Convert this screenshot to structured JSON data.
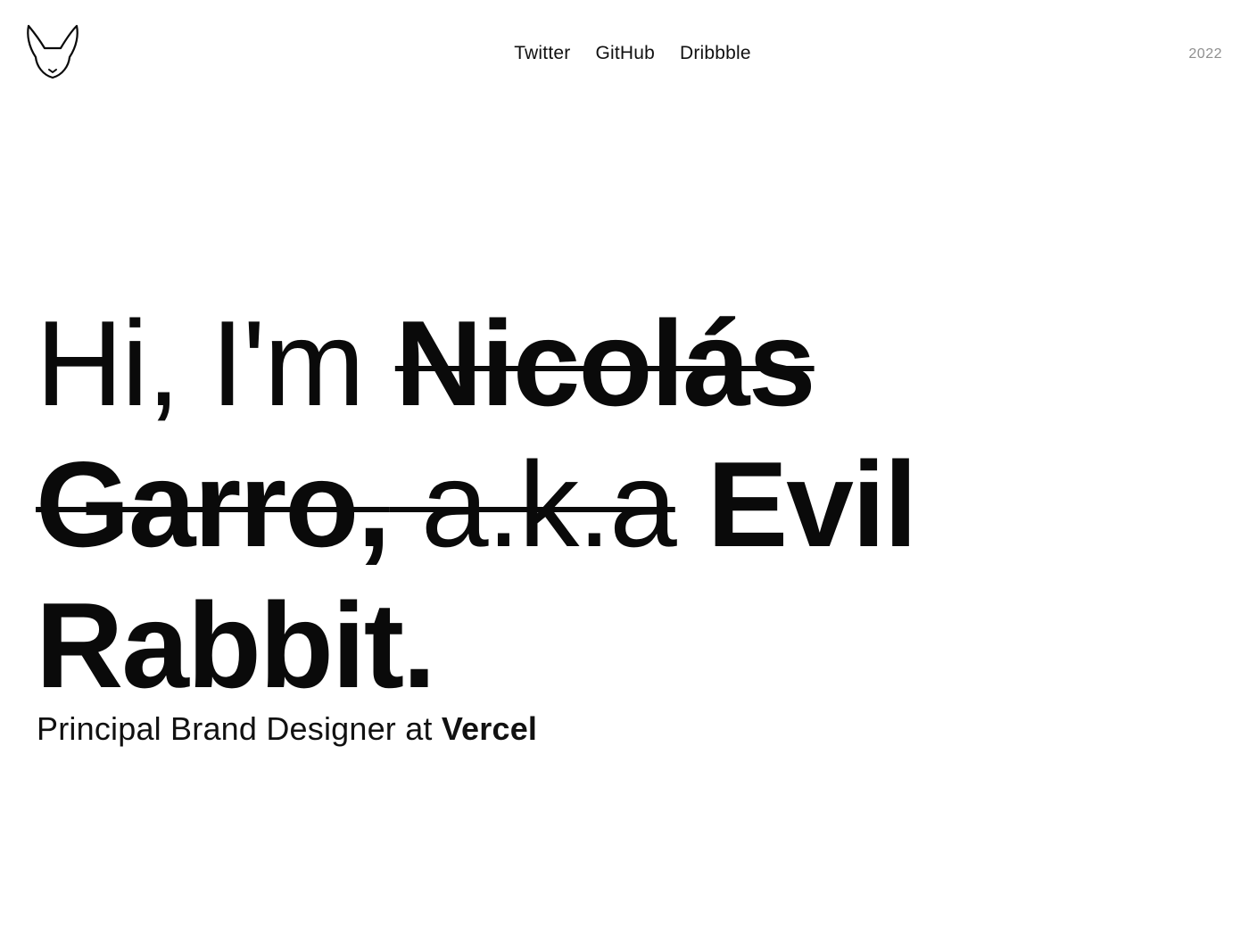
{
  "header": {
    "logo_icon": "rabbit-head-icon",
    "nav": {
      "twitter": "Twitter",
      "github": "GitHub",
      "dribbble": "Dribbble"
    },
    "year": "2022"
  },
  "hero": {
    "greeting": "Hi, I'm ",
    "struck_name": "Nicolás Garro,",
    "struck_aka": " a.k.a",
    "alias": " Evil Rabbit."
  },
  "tagline": {
    "role": "Principal Brand Designer at ",
    "company": "Vercel"
  },
  "colors": {
    "text": "#0a0a0a",
    "muted": "#8f8f8f",
    "background": "#ffffff"
  }
}
